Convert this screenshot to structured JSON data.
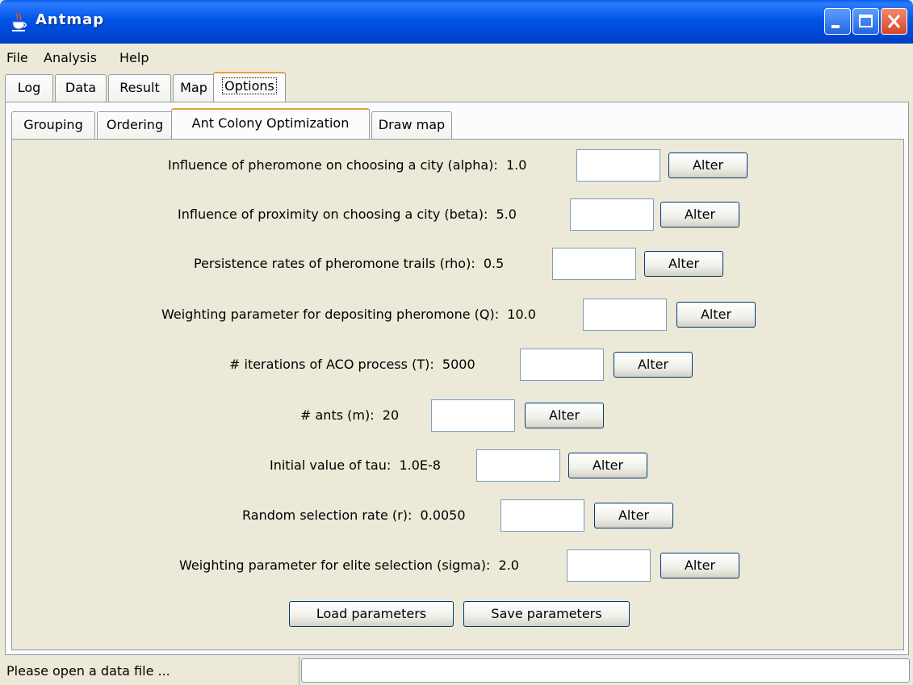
{
  "window": {
    "title": "Antmap",
    "icon": "java-cup-icon"
  },
  "menu": [
    "File",
    "Analysis",
    "Help"
  ],
  "tabs": [
    "Log",
    "Data",
    "Result",
    "Map",
    "Options"
  ],
  "subtabs": [
    "Grouping",
    "Ordering",
    "Ant Colony Optimization",
    "Draw map"
  ],
  "params": [
    {
      "label": "Influence of pheromone on choosing a city (alpha):",
      "value": "1.0",
      "button": "Alter"
    },
    {
      "label": "Influence of proximity on choosing a city (beta):",
      "value": "5.0",
      "button": "Alter"
    },
    {
      "label": "Persistence rates of pheromone trails (rho):",
      "value": "0.5",
      "button": "Alter"
    },
    {
      "label": "Weighting parameter for depositing pheromone (Q):",
      "value": "10.0",
      "button": "Alter"
    },
    {
      "label": "# iterations of ACO process (T):",
      "value": "5000",
      "button": "Alter"
    },
    {
      "label": "# ants (m):",
      "value": "20",
      "button": "Alter"
    },
    {
      "label": "Initial value of tau:",
      "value": "1.0E-8",
      "button": "Alter"
    },
    {
      "label": "Random selection rate (r):",
      "value": "0.0050",
      "button": "Alter"
    },
    {
      "label": "Weighting parameter for elite selection (sigma):",
      "value": "2.0",
      "button": "Alter"
    }
  ],
  "actions": {
    "load": "Load parameters",
    "save": "Save parameters"
  },
  "status": {
    "text": "Please open a data file ..."
  },
  "colors": {
    "titlebar": "#0055e5",
    "tab_highlight": "#e6a13a",
    "panel": "#ece9d8"
  }
}
